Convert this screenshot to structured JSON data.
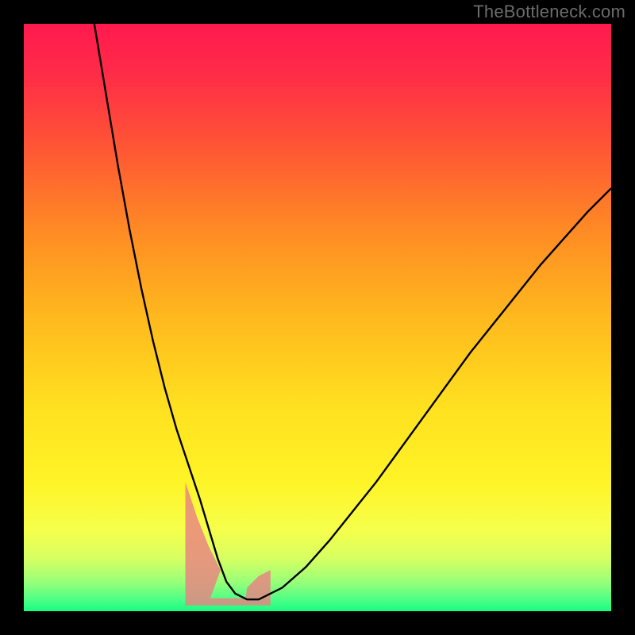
{
  "watermark": "TheBottleneck.com",
  "chart_data": {
    "type": "line",
    "title": "",
    "xlabel": "",
    "ylabel": "",
    "xlim": [
      0,
      100
    ],
    "ylim": [
      0,
      100
    ],
    "curve": {
      "x": [
        12,
        14,
        16,
        18,
        20,
        22,
        24,
        26,
        28,
        30,
        31.5,
        33,
        34.5,
        36,
        38,
        40,
        44,
        48,
        52,
        56,
        60,
        64,
        68,
        72,
        76,
        80,
        84,
        88,
        92,
        96,
        100
      ],
      "y": [
        100,
        88,
        76,
        65,
        55,
        46,
        38,
        31,
        25,
        19,
        14,
        9,
        5,
        3,
        2,
        2,
        4,
        7.5,
        12,
        17,
        22,
        27.5,
        33,
        38.5,
        44,
        49,
        54,
        59,
        63.5,
        68,
        72
      ]
    },
    "mask_band": {
      "x_start": 27.5,
      "x_end": 42,
      "y_low": 1,
      "y_high_left": 22,
      "y_high_right": 7
    },
    "gradient_stops": [
      {
        "pos": 0.0,
        "color": "#ff1a4e"
      },
      {
        "pos": 0.08,
        "color": "#ff2a49"
      },
      {
        "pos": 0.2,
        "color": "#ff5236"
      },
      {
        "pos": 0.35,
        "color": "#ff8a24"
      },
      {
        "pos": 0.5,
        "color": "#ffb91e"
      },
      {
        "pos": 0.65,
        "color": "#ffe01f"
      },
      {
        "pos": 0.78,
        "color": "#fff427"
      },
      {
        "pos": 0.86,
        "color": "#f6ff4a"
      },
      {
        "pos": 0.91,
        "color": "#d7ff62"
      },
      {
        "pos": 0.95,
        "color": "#99ff78"
      },
      {
        "pos": 0.98,
        "color": "#4dff86"
      },
      {
        "pos": 1.0,
        "color": "#19fc84"
      }
    ],
    "mask_color": "#e98383",
    "curve_stroke": "#000000",
    "curve_width": 2.4
  }
}
